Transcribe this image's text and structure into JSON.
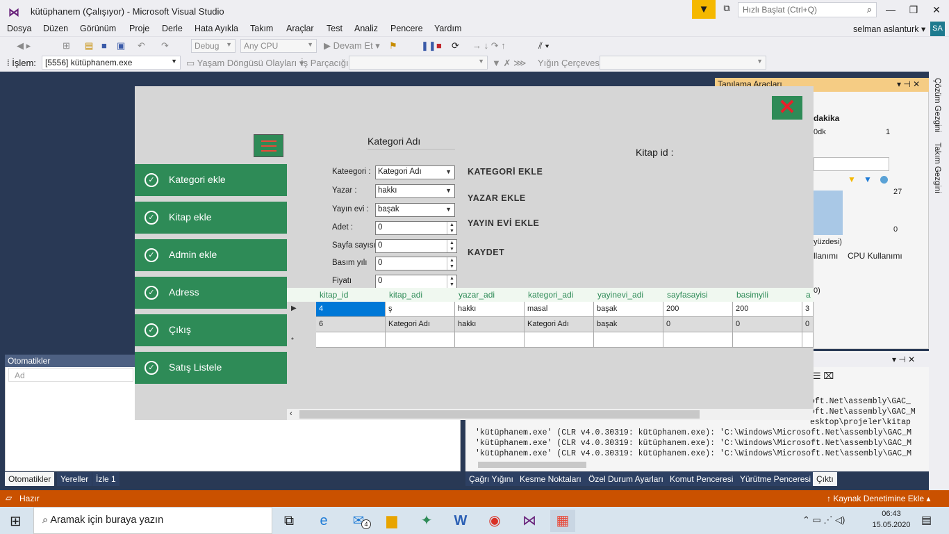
{
  "titlebar": {
    "title": "kütüphanem (Çalışıyor) - Microsoft Visual Studio",
    "quick_launch_placeholder": "Hızlı Başlat (Ctrl+Q)"
  },
  "menu": [
    "Dosya",
    "Düzen",
    "Görünüm",
    "Proje",
    "Derle",
    "Hata Ayıkla",
    "Takım",
    "Araçlar",
    "Test",
    "Analiz",
    "Pencere",
    "Yardım"
  ],
  "account": {
    "user": "selman aslanturk",
    "initials": "SA"
  },
  "toolbar": {
    "config": "Debug",
    "platform": "Any CPU",
    "continue_label": "Devam Et",
    "process_label": "İşlem:",
    "process_value": "[5556] kütüphanem.exe",
    "lifecycle_label": "Yaşam Döngüsü Olayları",
    "thread_label": "İş Parçacığı:",
    "stackframe_label": "Yığın Çerçevesi:"
  },
  "side_tabs": [
    "Çözüm Gezgini",
    "Takım Gezgini"
  ],
  "diagnostics": {
    "title": "Tanılama Araçları",
    "items": [
      "dakika",
      "0dk",
      "1",
      "27",
      "0",
      "yüzdesi)",
      "llanımı",
      "CPU Kullanımı",
      "0)"
    ]
  },
  "autos": {
    "title": "Otomatikler",
    "search_placeholder": "Ad"
  },
  "output": {
    "lines": [
      "oft.Net\\assembly\\GAC_",
      "oft.Net\\assembly\\GAC_M",
      "esktop\\projeler\\kitap",
      "'kütüphanem.exe' (CLR v4.0.30319: kütüphanem.exe): 'C:\\Windows\\Microsoft.Net\\assembly\\GAC_M",
      "'kütüphanem.exe' (CLR v4.0.30319: kütüphanem.exe): 'C:\\Windows\\Microsoft.Net\\assembly\\GAC_M",
      "'kütüphanem.exe' (CLR v4.0.30319: kütüphanem.exe): 'C:\\Windows\\Microsoft.Net\\assembly\\GAC_M"
    ]
  },
  "bottom_tabs_left": [
    "Otomatikler",
    "Yereller",
    "İzle 1"
  ],
  "bottom_tabs_right": [
    "Çağrı Yığını",
    "Kesme Noktaları",
    "Özel Durum Ayarları",
    "Komut Penceresi",
    "Yürütme Penceresi",
    "Çıktı"
  ],
  "status": {
    "text": "Hazır",
    "source_control": "Kaynak Denetimine Ekle"
  },
  "taskbar": {
    "search_placeholder": "Aramak için buraya yazın",
    "mail_badge": "4",
    "time": "06:43",
    "date": "15.05.2020"
  },
  "app": {
    "sidebar": [
      "Kategori ekle",
      "Kitap ekle",
      "Admin ekle",
      "Adress",
      "Çıkış",
      "Satış Listele"
    ],
    "header": "Kategori Adı",
    "kitap_id_label": "Kitap id :",
    "fields": [
      {
        "label": "Kateegori :",
        "value": "Kategori Adı"
      },
      {
        "label": "Yazar :",
        "value": "hakkı"
      },
      {
        "label": "Yayın evi :",
        "value": "başak"
      },
      {
        "label": "Adet :",
        "value": "0"
      },
      {
        "label": "Sayfa sayısı",
        "value": "0"
      },
      {
        "label": "Basım yılı",
        "value": "0"
      },
      {
        "label": "Fiyatı",
        "value": "0"
      }
    ],
    "actions": [
      "KATEGORİ EKLE",
      "YAZAR EKLE",
      "YAYIN EVİ EKLE",
      "KAYDET"
    ],
    "grid": {
      "columns": [
        "kitap_id",
        "kitap_adi",
        "yazar_adi",
        "kategori_adi",
        "yayinevi_adi",
        "sayfasayisi",
        "basimyili",
        "a"
      ],
      "rows": [
        [
          "4",
          "ş",
          "hakkı",
          "masal",
          "başak",
          "200",
          "200",
          "3"
        ],
        [
          "6",
          "Kategori Adı",
          "hakkı",
          "Kategori Adı",
          "başak",
          "0",
          "0",
          "0"
        ]
      ],
      "new_row_marker": "*"
    }
  }
}
